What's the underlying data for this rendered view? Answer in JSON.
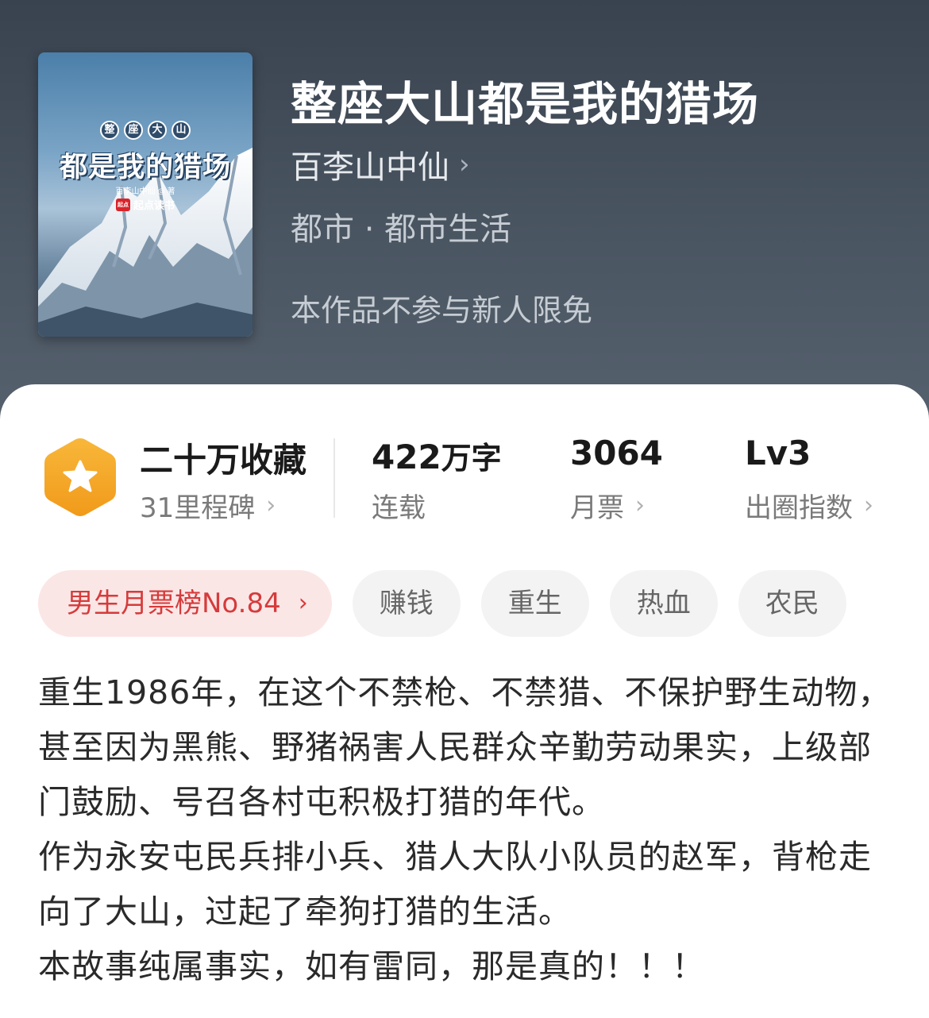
{
  "book": {
    "title": "整座大山都是我的猎场",
    "author": "百李山中仙",
    "category": "都市 · 都市生活",
    "promo_note": "本作品不参与新人限免"
  },
  "cover": {
    "badges": [
      "整",
      "座",
      "大",
      "山"
    ],
    "title": "都是我的猎场",
    "author_line": "百李山中仙 ◎ 著",
    "publisher_logo": "起点",
    "publisher": "起点读书"
  },
  "stats": {
    "favorites": {
      "main": "二十万收藏",
      "sub": "31里程碑"
    },
    "words": {
      "number": "422",
      "unit": "万字",
      "sub": "连载"
    },
    "monthly_tickets": {
      "main": "3064",
      "sub": "月票"
    },
    "influence": {
      "main": "Lv3",
      "sub": "出圈指数"
    }
  },
  "tags": {
    "rank": "男生月票榜No.84",
    "items": [
      "赚钱",
      "重生",
      "热血",
      "农民"
    ]
  },
  "description": [
    "重生1986年，在这个不禁枪、不禁猎、不保护野生动物，甚至因为黑熊、野猪祸害人民群众辛勤劳动果实，上级部门鼓励、号召各村屯积极打猎的年代。",
    "作为永安屯民兵排小兵、猎人大队小队员的赵军，背枪走向了大山，过起了牵狗打猎的生活。",
    "本故事纯属事实，如有雷同，那是真的！！！"
  ],
  "colors": {
    "header_bg": "#434d59",
    "medal_orange": "#f5a623",
    "rank_red": "#d63b3b",
    "rank_bg": "#fbe6e6"
  },
  "icons": {
    "author_chevron": "chevron-right-icon",
    "medal": "star-hexagon-icon"
  }
}
